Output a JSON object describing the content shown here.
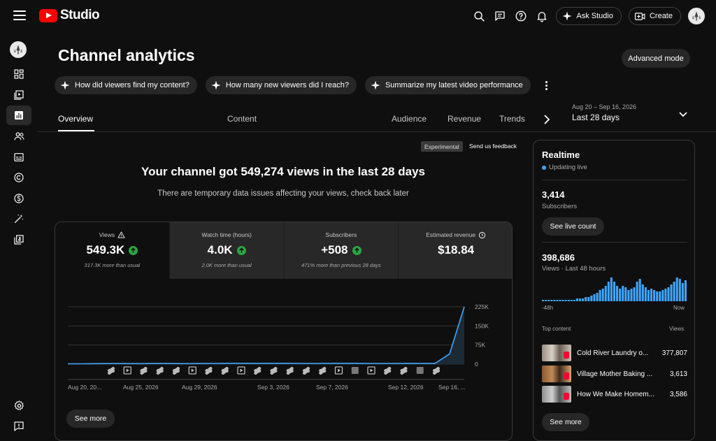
{
  "header": {
    "logo_text": "Studio",
    "ask_label": "Ask Studio",
    "create_label": "Create"
  },
  "page": {
    "title": "Channel analytics",
    "advanced_label": "Advanced mode"
  },
  "chips": [
    {
      "label": "How did viewers find my content?"
    },
    {
      "label": "How many new viewers did I reach?"
    },
    {
      "label": "Summarize my latest video performance"
    }
  ],
  "tabs": [
    {
      "label": "Overview",
      "active": true
    },
    {
      "label": "Content"
    },
    {
      "label": "Audience"
    },
    {
      "label": "Revenue"
    },
    {
      "label": "Trends"
    }
  ],
  "date_range": {
    "sub": "Aug 20 – Sep 16, 2026",
    "label": "Last 28 days"
  },
  "insight": {
    "badge": "Experimental",
    "feedback": "Send us feedback",
    "headline": "Your channel got 549,274 views in the last 28 days",
    "subhead": "There are temporary data issues affecting your views, check back later"
  },
  "metrics": [
    {
      "label": "Views",
      "value": "549.3K",
      "note": "317.3K more than usual",
      "icon": "warning-icon",
      "up": true
    },
    {
      "label": "Watch time (hours)",
      "value": "4.0K",
      "note": "2.0K more than usual",
      "up": true
    },
    {
      "label": "Subscribers",
      "value": "+508",
      "note": "471% more than previous 28 days",
      "up": true
    },
    {
      "label": "Estimated revenue",
      "value": "$18.84",
      "note": "",
      "icon": "clock-icon"
    }
  ],
  "chart_data": {
    "type": "area",
    "ylim": [
      0,
      225000
    ],
    "y_ticks": [
      "225K",
      "150K",
      "75K",
      "0"
    ],
    "x_ticks": [
      "Aug 20, 20...",
      "Aug 25, 2026",
      "Aug 29, 2026",
      "Sep 3, 2026",
      "Sep 7, 2026",
      "Sep 12, 2026",
      "Sep 16, ..."
    ],
    "x": [
      "Aug 20",
      "Aug 21",
      "Aug 22",
      "Aug 23",
      "Aug 24",
      "Aug 25",
      "Aug 26",
      "Aug 27",
      "Aug 28",
      "Aug 29",
      "Aug 30",
      "Aug 31",
      "Sep 1",
      "Sep 2",
      "Sep 3",
      "Sep 4",
      "Sep 5",
      "Sep 6",
      "Sep 7",
      "Sep 8",
      "Sep 9",
      "Sep 10",
      "Sep 11",
      "Sep 12",
      "Sep 13",
      "Sep 14",
      "Sep 15",
      "Sep 16"
    ],
    "values": [
      1500,
      1500,
      1800,
      2200,
      2200,
      1800,
      2600,
      2500,
      1800,
      2500,
      2800,
      3200,
      3400,
      2900,
      3300,
      3200,
      2700,
      2800,
      3400,
      3400,
      3000,
      2700,
      2800,
      3100,
      2900,
      2500,
      40000,
      225000
    ],
    "line_color": "#3ea6ff",
    "grid": true,
    "markers": [
      "shorts",
      "video",
      "shorts",
      "shorts",
      "shorts",
      "video",
      "shorts",
      "shorts",
      "video",
      "shorts",
      "shorts",
      "shorts",
      "shorts",
      "shorts",
      "video",
      "numbered",
      "video",
      "shorts",
      "shorts",
      "numbered",
      "shorts"
    ],
    "see_more": "See more"
  },
  "realtime": {
    "title": "Realtime",
    "status": "Updating live",
    "subs_value": "3,414",
    "subs_label": "Subscribers",
    "live_count_btn": "See live count",
    "views_value": "398,686",
    "views_label": "Views · Last 48 hours",
    "axis_start": "-48h",
    "axis_end": "Now",
    "bars": [
      1,
      1,
      1,
      1,
      1,
      1,
      1,
      1,
      1,
      1,
      1,
      1,
      2,
      2,
      2,
      3,
      3,
      4,
      5,
      6,
      8,
      9,
      11,
      14,
      17,
      14,
      11,
      9,
      11,
      10,
      8,
      9,
      10,
      14,
      16,
      12,
      10,
      8,
      9,
      8,
      7,
      7,
      8,
      9,
      10,
      12,
      14,
      17,
      16,
      13,
      15
    ],
    "top_content_label": "Top content",
    "top_views_label": "Views",
    "top_content": [
      {
        "title": "Cold River Laundry o...",
        "views": "377,807"
      },
      {
        "title": "Village Mother Baking ...",
        "views": "3,613"
      },
      {
        "title": "How We Make Homem...",
        "views": "3,586"
      }
    ],
    "see_more": "See more"
  }
}
